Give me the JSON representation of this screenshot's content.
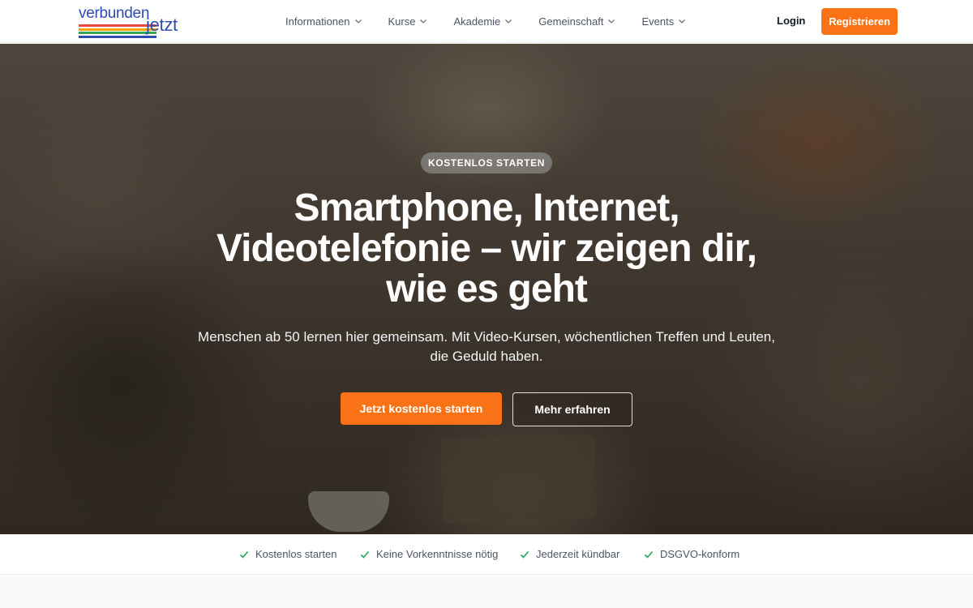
{
  "brand": {
    "logo_part1": "verbunden",
    "logo_part2": "jetzt",
    "logo_stripe_colors": [
      "#e94b3c",
      "#f7a400",
      "#2fa84f",
      "#2d4bb0"
    ]
  },
  "nav": {
    "items": [
      {
        "label": "Informationen",
        "icon": "chevron-down-icon"
      },
      {
        "label": "Kurse",
        "icon": "chevron-down-icon"
      },
      {
        "label": "Akademie",
        "icon": "chevron-down-icon"
      },
      {
        "label": "Gemeinschaft",
        "icon": "chevron-down-icon"
      },
      {
        "label": "Events",
        "icon": "chevron-down-icon"
      }
    ],
    "login_label": "Login",
    "register_label": "Registrieren"
  },
  "hero": {
    "badge": "KOSTENLOS STARTEN",
    "headline_line1": "Smartphone, Internet,",
    "headline_line2": "Videotelefonie – wir zeigen dir,",
    "headline_line3": "wie es geht",
    "subline_line1": "Menschen ab 50 lernen hier gemeinsam. Mit Video-Kursen, wöchentlichen Treffen und Leuten,",
    "subline_line2": "die Geduld haben.",
    "primary_cta": "Jetzt kostenlos starten",
    "secondary_cta": "Mehr erfahren"
  },
  "trust": {
    "items": [
      {
        "label": "Kostenlos starten",
        "icon": "check-icon"
      },
      {
        "label": "Keine Vorkenntnisse nötig",
        "icon": "check-icon"
      },
      {
        "label": "Jederzeit kündbar",
        "icon": "check-icon"
      },
      {
        "label": "DSGVO-konform",
        "icon": "check-icon"
      }
    ]
  },
  "colors": {
    "accent": "#f97316",
    "brand_blue": "#2d4bb0",
    "check_green": "#22a559"
  }
}
